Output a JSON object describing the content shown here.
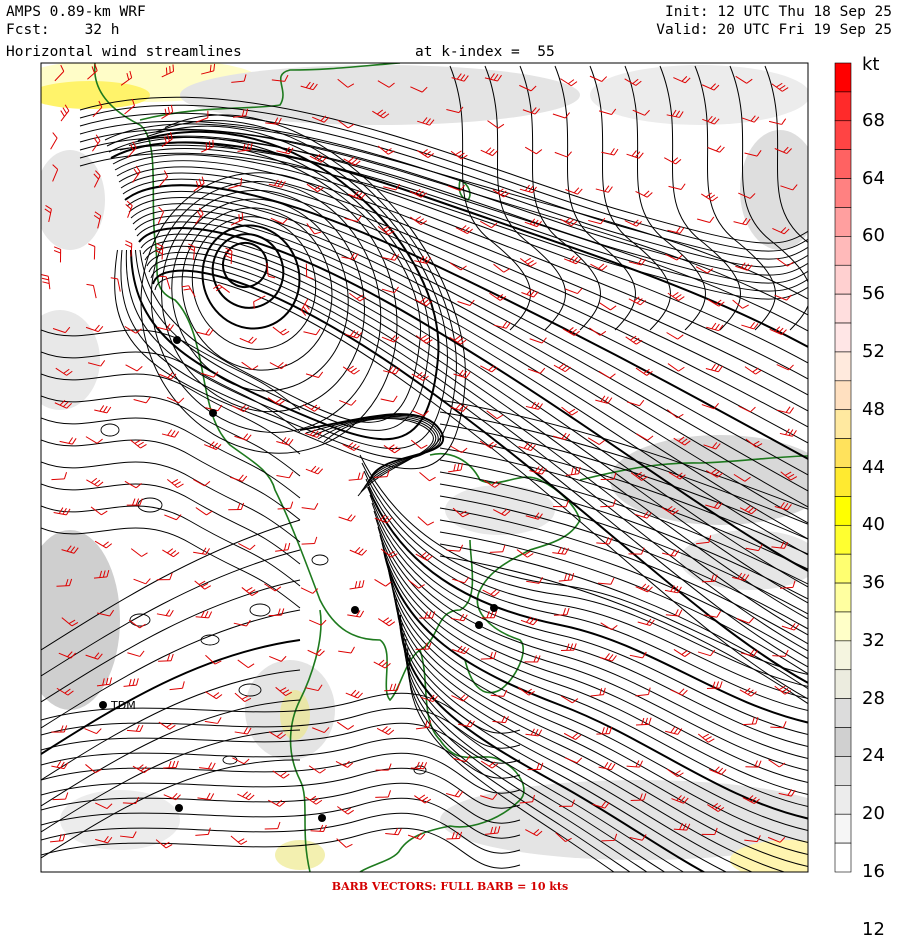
{
  "header": {
    "model": "AMPS 0.89-km WRF",
    "forecast": "Fcst:    32 h",
    "product": "Horizontal wind streamlines",
    "level": "at k-index =  55",
    "init": "Init: 12 UTC Thu 18 Sep 25",
    "valid": "Valid: 20 UTC Fri 19 Sep 25"
  },
  "colorbar": {
    "unit": "kt",
    "labels": [
      "68",
      "64",
      "60",
      "56",
      "52",
      "48",
      "44",
      "40",
      "36",
      "32",
      "28",
      "24",
      "20",
      "16",
      "12"
    ],
    "bins": [
      {
        "color": "#ff0000"
      },
      {
        "color": "#ff2a2a"
      },
      {
        "color": "#ff4444"
      },
      {
        "color": "#ff6262"
      },
      {
        "color": "#ff8181"
      },
      {
        "color": "#ff9f9f"
      },
      {
        "color": "#ffbaba"
      },
      {
        "color": "#ffd0d0"
      },
      {
        "color": "#ffdede"
      },
      {
        "color": "#ffe6e6"
      },
      {
        "color": "#ffeadd"
      },
      {
        "color": "#ffe0c0"
      },
      {
        "color": "#ffe9a0"
      },
      {
        "color": "#ffe25c"
      },
      {
        "color": "#ffea30"
      },
      {
        "color": "#ffff00"
      },
      {
        "color": "#ffff30"
      },
      {
        "color": "#ffff70"
      },
      {
        "color": "#ffffa0"
      },
      {
        "color": "#ffffc8"
      },
      {
        "color": "#f5f5e0"
      },
      {
        "color": "#ececdf"
      },
      {
        "color": "#dcdcdc"
      },
      {
        "color": "#d0d0d0"
      },
      {
        "color": "#e0e0e0"
      },
      {
        "color": "#ececec"
      },
      {
        "color": "#f6f6f6"
      },
      {
        "color": "#ffffff"
      }
    ]
  },
  "stations": [
    {
      "label": ""
    },
    {
      "label": ""
    },
    {
      "label": ""
    },
    {
      "label": ""
    },
    {
      "label": ""
    },
    {
      "label": "TDM"
    },
    {
      "label": ""
    },
    {
      "label": ""
    }
  ],
  "footer": "BARB VECTORS:  FULL BARB = 10 kts",
  "colors": {
    "streamline": "#000000",
    "barb": "#dd0000",
    "coast": "#1e7a1e"
  }
}
